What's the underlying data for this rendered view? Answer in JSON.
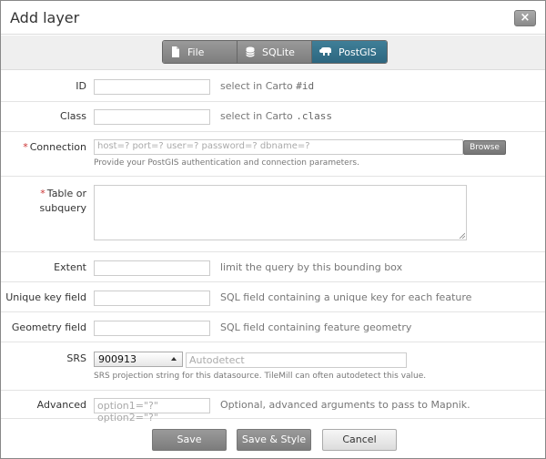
{
  "dialog": {
    "title": "Add layer",
    "close_label": "×"
  },
  "tabs": [
    {
      "label": "File",
      "icon": "file-icon",
      "active": false
    },
    {
      "label": "SQLite",
      "icon": "database-icon",
      "active": false
    },
    {
      "label": "PostGIS",
      "icon": "elephant-icon",
      "active": true
    }
  ],
  "fields": {
    "id": {
      "label": "ID",
      "value": "",
      "hint_prefix": "select in Carto",
      "hint_code": "#id"
    },
    "class": {
      "label": "Class",
      "value": "",
      "hint_prefix": "select in Carto",
      "hint_code": ".class"
    },
    "connection": {
      "label": "Connection",
      "required_mark": "*",
      "placeholder": "host=? port=? user=? password=? dbname=?",
      "browse_label": "Browse",
      "help": "Provide your PostGIS authentication and connection parameters."
    },
    "table": {
      "label_line1": "Table or",
      "label_line2": "subquery",
      "required_mark": "*",
      "value": ""
    },
    "extent": {
      "label": "Extent",
      "value": "",
      "hint": "limit the query by this bounding box"
    },
    "unique_key": {
      "label": "Unique key field",
      "value": "",
      "hint": "SQL field containing a unique key for each feature"
    },
    "geometry": {
      "label": "Geometry field",
      "value": "",
      "hint": "SQL field containing feature geometry"
    },
    "srs": {
      "label": "SRS",
      "selected": "900913",
      "placeholder": "Autodetect",
      "help": "SRS projection string for this datasource. TileMill can often autodetect this value."
    },
    "advanced": {
      "label": "Advanced",
      "placeholder": "option1=\"?\" option2=\"?\"",
      "hint": "Optional, advanced arguments to pass to Mapnik."
    }
  },
  "footer": {
    "save_label": "Save",
    "save_style_label": "Save & Style",
    "cancel_label": "Cancel"
  },
  "colors": {
    "active_tab": "#2d6780",
    "required": "#cc3333"
  }
}
